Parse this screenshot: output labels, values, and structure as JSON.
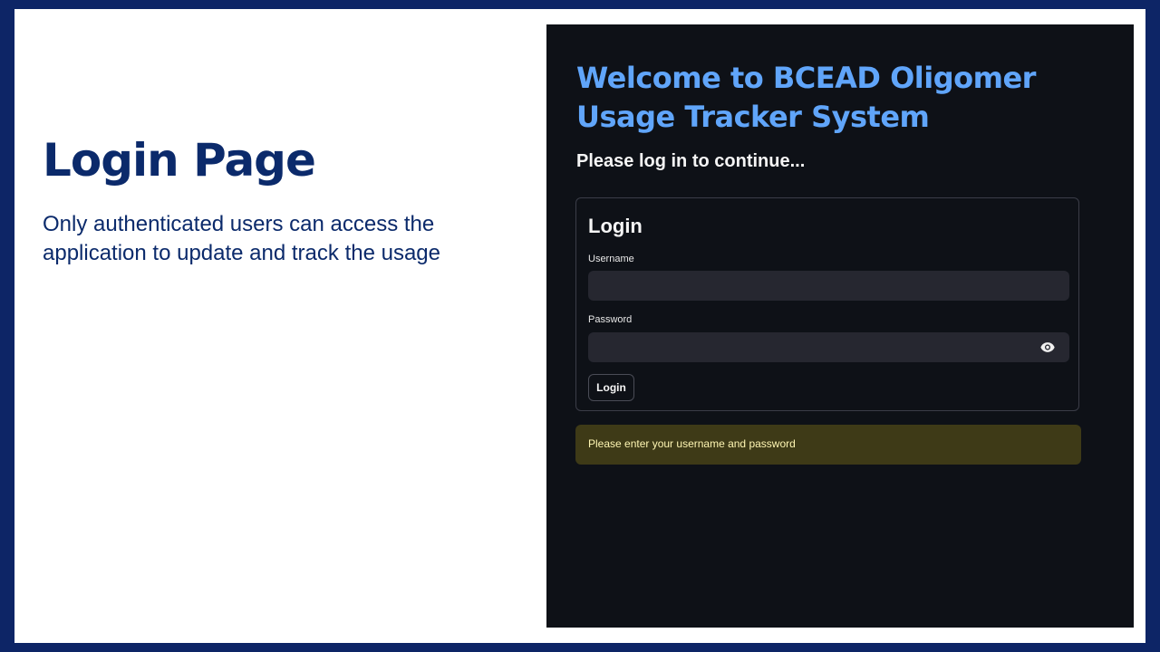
{
  "slide": {
    "title": "Login Page",
    "description": "Only authenticated users can access the application to update and track the usage"
  },
  "app": {
    "title": "Welcome to BCEAD Oligomer Usage Tracker System",
    "subtitle": "Please log in to continue...",
    "form": {
      "heading": "Login",
      "username_label": "Username",
      "username_value": "",
      "password_label": "Password",
      "password_value": "",
      "password_toggle_icon": "eye-icon",
      "submit_label": "Login"
    },
    "warning": "Please enter your username and password"
  },
  "colors": {
    "frame": "#0d2566",
    "slide_text": "#0b2a6b",
    "app_background": "#0e1117",
    "app_title": "#60a5fa",
    "input_background": "#262730",
    "warning_background": "#3e3a17",
    "warning_text": "#fff6b3"
  }
}
